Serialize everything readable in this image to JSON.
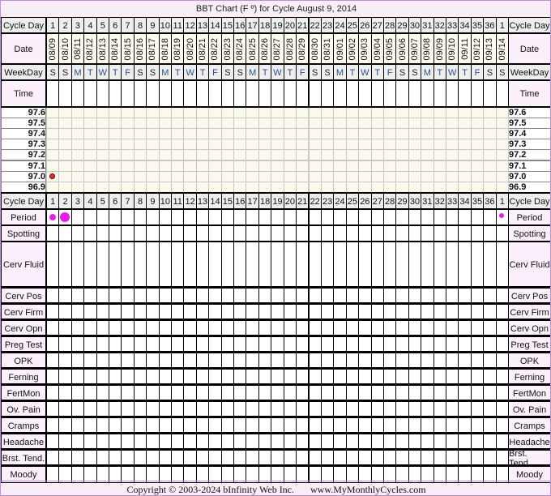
{
  "title": "BBT Chart (F º) for Cycle August 9, 2014",
  "cycle_days": [
    "1",
    "2",
    "3",
    "4",
    "5",
    "6",
    "7",
    "8",
    "9",
    "10",
    "11",
    "12",
    "13",
    "14",
    "15",
    "16",
    "17",
    "18",
    "19",
    "20",
    "21",
    "22",
    "23",
    "24",
    "25",
    "26",
    "27",
    "28",
    "29",
    "30",
    "31",
    "32",
    "33",
    "34",
    "35",
    "36",
    "1"
  ],
  "dates": [
    "08/09",
    "08/10",
    "08/11",
    "08/12",
    "08/13",
    "08/14",
    "08/15",
    "08/16",
    "08/17",
    "08/18",
    "08/19",
    "08/20",
    "08/21",
    "08/22",
    "08/23",
    "08/24",
    "08/25",
    "08/26",
    "08/27",
    "08/28",
    "08/29",
    "08/30",
    "08/31",
    "09/01",
    "09/02",
    "09/03",
    "09/04",
    "09/05",
    "09/06",
    "09/07",
    "09/08",
    "09/09",
    "09/10",
    "09/11",
    "09/12",
    "09/13",
    "09/14"
  ],
  "weekdays": [
    "S",
    "S",
    "M",
    "T",
    "W",
    "T",
    "F",
    "S",
    "S",
    "M",
    "T",
    "W",
    "T",
    "F",
    "S",
    "S",
    "M",
    "T",
    "W",
    "T",
    "F",
    "S",
    "S",
    "M",
    "T",
    "W",
    "T",
    "F",
    "S",
    "S",
    "M",
    "T",
    "W",
    "T",
    "F",
    "S",
    "S"
  ],
  "labels": {
    "cycle_day": "Cycle Day",
    "date": "Date",
    "weekday": "WeekDay",
    "time": "Time"
  },
  "temps": [
    "97.6",
    "97.5",
    "97.4",
    "97.3",
    "97.2",
    "97.1",
    "97.0",
    "96.9"
  ],
  "temp_points": [
    {
      "day": 1,
      "temp": 97.0
    }
  ],
  "period": [
    {
      "day": 1,
      "size": "medium"
    },
    {
      "day": 2,
      "size": "heavy"
    },
    {
      "day": 37,
      "size": "light"
    }
  ],
  "rows": [
    "Period",
    "Spotting",
    "Cerv Fluid",
    "Cerv Pos",
    "Cerv Firm",
    "Cerv Opn",
    "Preg Test",
    "OPK",
    "Ferning",
    "FertMon",
    "Ov. Pain",
    "Cramps",
    "Headache",
    "Brst. Tend.",
    "Moody"
  ],
  "colors": {
    "period": "#e81ee8",
    "temp_dot": "#e03030",
    "label_bg": "#fdf0fd",
    "header_bg": "#eeeeee",
    "temp_bg": "#fbf8ec",
    "border": "#c58be0"
  },
  "copyright": "Copyright © 2003-2024 bInfinity Web Inc.",
  "site": "www.MyMonthlyCycles.com"
}
